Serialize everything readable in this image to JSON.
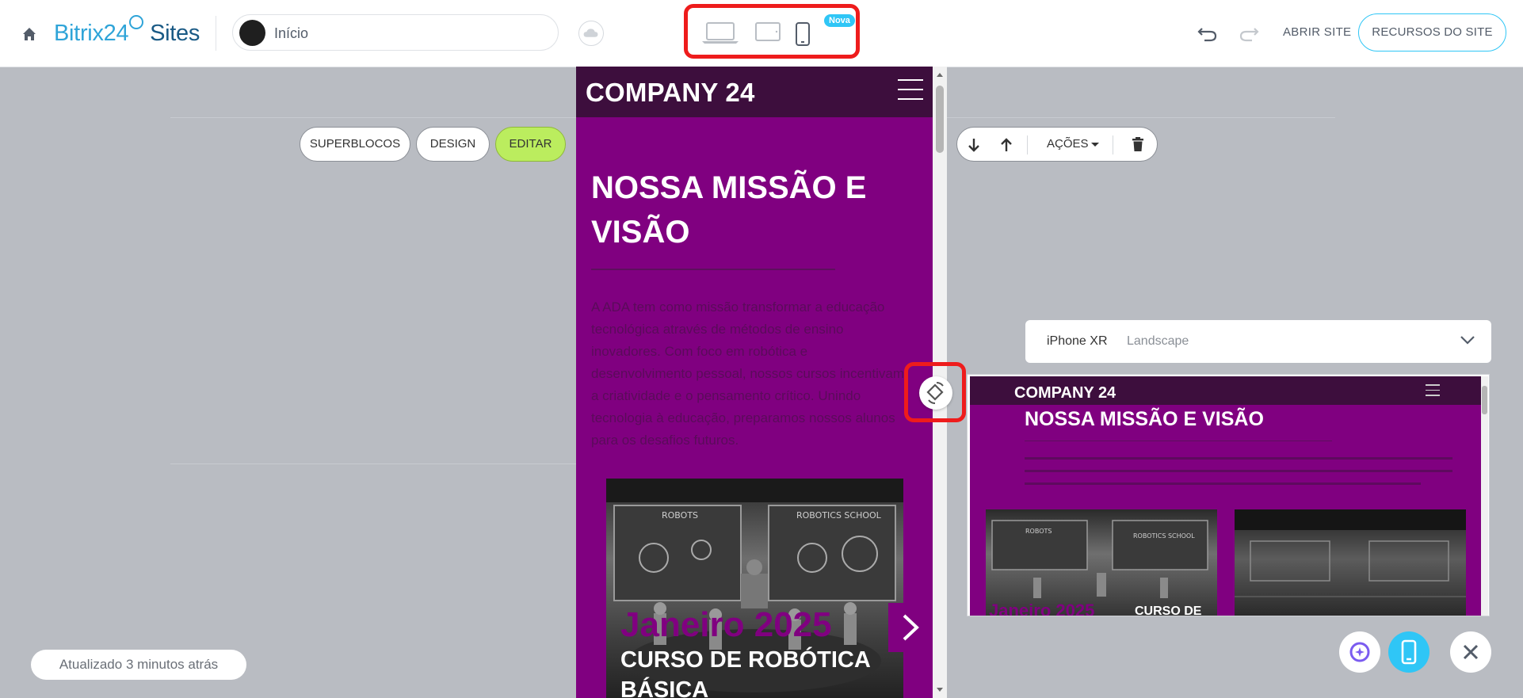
{
  "header": {
    "brand_part1": "Bitrix24",
    "brand_part2": "Sites",
    "page_selector": "Início",
    "device_badge": "Nova",
    "open_site": "ABRIR SITE",
    "site_resources": "RECURSOS DO SITE"
  },
  "toolbar": {
    "superblocks": "SUPERBLOCOS",
    "design": "DESIGN",
    "edit": "EDITAR",
    "actions": "AÇÕES"
  },
  "mobile_preview": {
    "company": "COMPANY 24",
    "title": "NOSSA MISSÃO E VISÃO",
    "body": "A ADA tem como missão transformar a educação tecnológica através de métodos de ensino inovadores. Com foco em robótica e desenvolvimento pessoal, nossos cursos incentivam a criatividade e o pensamento crítico. Unindo tecnologia à educação, preparamos nossos alunos para os desafios futuros.",
    "event_date": "Janeiro 2025",
    "event_title": "CURSO DE ROBÓTICA BÁSICA",
    "image_sign_1": "ROBOTS",
    "image_sign_2": "ROBOTICS SCHOOL"
  },
  "device_panel": {
    "device": "iPhone XR",
    "orientation": "Landscape",
    "preview": {
      "company": "COMPANY 24",
      "title": "NOSSA MISSÃO E VISÃO",
      "event_date": "Janeiro 2025",
      "event_title": "CURSO DE",
      "image_sign_1": "ROBOTS",
      "image_sign_2": "ROBOTICS SCHOOL"
    }
  },
  "status": "Atualizado 3 minutos atrás",
  "colors": {
    "brand_light": "#2fa4d8",
    "brand_dark": "#1a5a85",
    "accent": "#2fc6f6",
    "edit_green": "#bbed5e",
    "purple": "#800080",
    "dark_purple": "#3d0e3d",
    "highlight_red": "#ee1c1c"
  }
}
